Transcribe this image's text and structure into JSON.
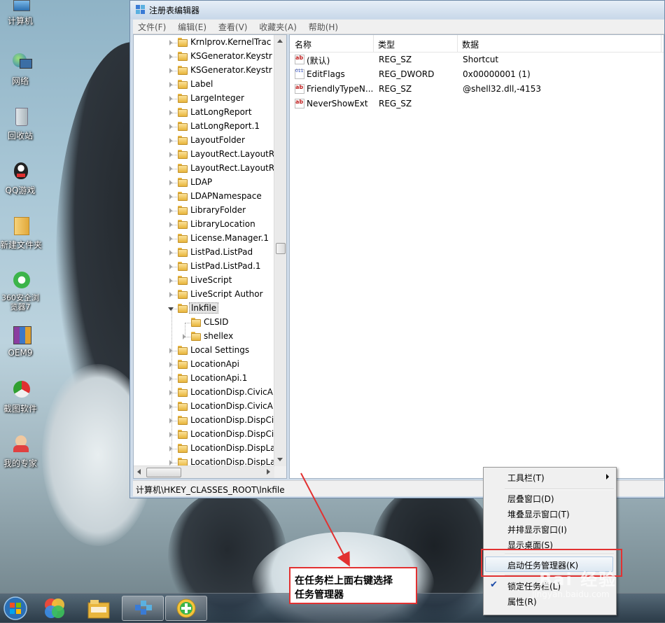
{
  "window": {
    "title": "注册表编辑器"
  },
  "menu": [
    "文件(F)",
    "编辑(E)",
    "查看(V)",
    "收藏夹(A)",
    "帮助(H)"
  ],
  "desktop_icons": [
    {
      "label": "计算机",
      "icon": "computer-icon"
    },
    {
      "label": "网络",
      "icon": "network-icon"
    },
    {
      "label": "回收站",
      "icon": "recycle-bin-icon"
    },
    {
      "label": "QQ游戏",
      "icon": "qq-game-icon"
    },
    {
      "label": "新建文件夹",
      "icon": "folder-icon"
    },
    {
      "label": "360安全浏览器7",
      "icon": "browser-360-icon"
    },
    {
      "label": "OEM9",
      "icon": "winrar-icon"
    },
    {
      "label": "截图软件",
      "icon": "screenshot-app-icon"
    },
    {
      "label": "我的专家",
      "icon": "expert-app-icon"
    }
  ],
  "tree": {
    "items": [
      {
        "label": "Krnlprov.KernelTrac",
        "level": 0,
        "expander": "collapsed"
      },
      {
        "label": "KSGenerator.Keystr",
        "level": 0,
        "expander": "collapsed"
      },
      {
        "label": "KSGenerator.Keystr",
        "level": 0,
        "expander": "collapsed"
      },
      {
        "label": "Label",
        "level": 0,
        "expander": "collapsed"
      },
      {
        "label": "LargeInteger",
        "level": 0,
        "expander": "collapsed"
      },
      {
        "label": "LatLongReport",
        "level": 0,
        "expander": "collapsed"
      },
      {
        "label": "LatLongReport.1",
        "level": 0,
        "expander": "collapsed"
      },
      {
        "label": "LayoutFolder",
        "level": 0,
        "expander": "collapsed"
      },
      {
        "label": "LayoutRect.LayoutRe",
        "level": 0,
        "expander": "collapsed"
      },
      {
        "label": "LayoutRect.LayoutRe",
        "level": 0,
        "expander": "collapsed"
      },
      {
        "label": "LDAP",
        "level": 0,
        "expander": "collapsed"
      },
      {
        "label": "LDAPNamespace",
        "level": 0,
        "expander": "collapsed"
      },
      {
        "label": "LibraryFolder",
        "level": 0,
        "expander": "collapsed"
      },
      {
        "label": "LibraryLocation",
        "level": 0,
        "expander": "collapsed"
      },
      {
        "label": "License.Manager.1",
        "level": 0,
        "expander": "collapsed"
      },
      {
        "label": "ListPad.ListPad",
        "level": 0,
        "expander": "collapsed"
      },
      {
        "label": "ListPad.ListPad.1",
        "level": 0,
        "expander": "collapsed"
      },
      {
        "label": "LiveScript",
        "level": 0,
        "expander": "collapsed"
      },
      {
        "label": "LiveScript Author",
        "level": 0,
        "expander": "collapsed"
      },
      {
        "label": "lnkfile",
        "level": 0,
        "expander": "expanded",
        "selected": true
      },
      {
        "label": "CLSID",
        "level": 1,
        "expander": "none"
      },
      {
        "label": "shellex",
        "level": 1,
        "expander": "collapsed"
      },
      {
        "label": "Local Settings",
        "level": 0,
        "expander": "collapsed"
      },
      {
        "label": "LocationApi",
        "level": 0,
        "expander": "collapsed"
      },
      {
        "label": "LocationApi.1",
        "level": 0,
        "expander": "collapsed"
      },
      {
        "label": "LocationDisp.CivicA",
        "level": 0,
        "expander": "collapsed"
      },
      {
        "label": "LocationDisp.CivicA",
        "level": 0,
        "expander": "collapsed"
      },
      {
        "label": "LocationDisp.DispCi",
        "level": 0,
        "expander": "collapsed"
      },
      {
        "label": "LocationDisp.DispCi",
        "level": 0,
        "expander": "collapsed"
      },
      {
        "label": "LocationDisp.DispLa",
        "level": 0,
        "expander": "collapsed"
      },
      {
        "label": "LocationDisp.DispLa",
        "level": 0,
        "expander": "collapsed"
      }
    ]
  },
  "list": {
    "columns": [
      "名称",
      "类型",
      "数据"
    ],
    "rows": [
      {
        "name": "(默认)",
        "type": "REG_SZ",
        "data": "Shortcut",
        "icon": "string-value-icon"
      },
      {
        "name": "EditFlags",
        "type": "REG_DWORD",
        "data": "0x00000001 (1)",
        "icon": "dword-value-icon"
      },
      {
        "name": "FriendlyTypeN...",
        "type": "REG_SZ",
        "data": "@shell32.dll,-4153",
        "icon": "string-value-icon"
      },
      {
        "name": "NeverShowExt",
        "type": "REG_SZ",
        "data": "",
        "icon": "string-value-icon"
      }
    ]
  },
  "status": {
    "path": "计算机\\HKEY_CLASSES_ROOT\\lnkfile"
  },
  "context_menu": {
    "toolbars": "工具栏(T)",
    "cascade": "层叠窗口(D)",
    "stacked": "堆叠显示窗口(T)",
    "side_by_side": "并排显示窗口(I)",
    "show_desktop": "显示桌面(S)",
    "task_manager": "启动任务管理器(K)",
    "lock_taskbar": "锁定任务栏(L)",
    "properties": "属性(R)"
  },
  "callout": {
    "line1": "在任务栏上面右键选择",
    "line2": "任务管理器"
  },
  "watermark": {
    "text": "Bai 经验",
    "url": "jingyan.baidu.com"
  },
  "colors": {
    "highlight_red": "#e23131",
    "selection_blue": "#1a4aa8"
  }
}
